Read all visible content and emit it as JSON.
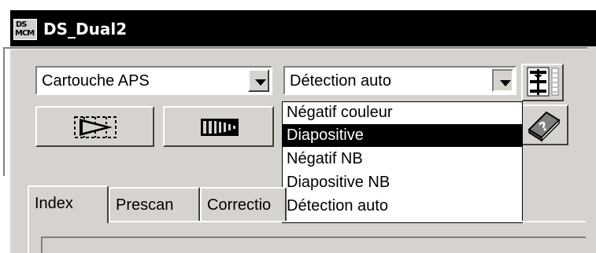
{
  "window": {
    "title": "DS_Dual2",
    "icon_text_top": "DS",
    "icon_text_bottom": "MCM"
  },
  "toolbar": {
    "film_holder": {
      "value": "Cartouche APS"
    },
    "film_type": {
      "value": "Détection auto",
      "options": [
        "Négatif couleur",
        "Diapositive",
        "Négatif NB",
        "Diapositive NB",
        "Détection auto"
      ],
      "highlighted": "Diapositive",
      "expanded": true
    }
  },
  "tabs": [
    {
      "label": "Index",
      "active": true
    },
    {
      "label": "Prescan",
      "active": false
    },
    {
      "label": "Correctio",
      "active": false
    }
  ],
  "colors": {
    "face": "#d6d3ce",
    "titlebar": "#000000",
    "highlight": "#000000"
  },
  "icons": [
    "app-icon",
    "chevron-down-icon",
    "settings-slider-icon",
    "scan-play-icon",
    "filmstrip-icon",
    "help-book-icon"
  ]
}
